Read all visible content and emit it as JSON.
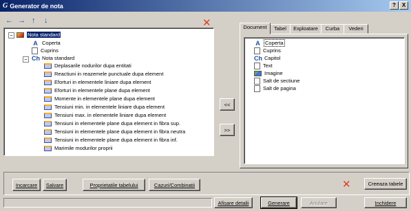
{
  "window": {
    "title": "Generator de nota",
    "app_icon": "G",
    "help_button": "?",
    "close_button": "X"
  },
  "toolbar": {
    "left_arrow": "←",
    "right_arrow": "→",
    "up_arrow": "↑",
    "down_arrow": "↓",
    "delete_icon": "✕"
  },
  "tree": {
    "root_label": "Nota standard",
    "root_expander": "−",
    "items": [
      {
        "icon": "A",
        "label": "Coperta"
      },
      {
        "icon": "doc",
        "label": "Cuprins"
      },
      {
        "icon": "Ch",
        "label": "Nota standard"
      }
    ],
    "chapter_expander": "−",
    "chapter_items": [
      "Deplasarile nodurilor dupa entitati",
      "Reactiuni in reazemele punctuale dupa element",
      "Eforturi in elementele liniare dupa element",
      "Eforturi in elementele plane dupa element",
      "Momente in elementele plane dupa element",
      "Tensiuni min. in elementele liniare dupa element",
      "Tensiuni max. in elementele liniare dupa element",
      "Tensiuni in elementele plane dupa element in fibra sup.",
      "Tensiuni in elementele plane dupa element in fibra neutra",
      "Tensiuni in elementele plane dupa element in fibra inf.",
      "Marimile modurilor proprii"
    ]
  },
  "middle": {
    "add_button": "<<",
    "remove_button": ">>"
  },
  "tabs": [
    "Document",
    "Tabel",
    "Exploatare",
    "Curba",
    "Vederi"
  ],
  "active_tab": "Document",
  "document_list": [
    {
      "icon": "A",
      "label": "Coperta"
    },
    {
      "icon": "doc",
      "label": "Cuprins"
    },
    {
      "icon": "Ch",
      "label": "Capitol"
    },
    {
      "icon": "doc",
      "label": "Text"
    },
    {
      "icon": "img",
      "label": "Imagine"
    },
    {
      "icon": "doc",
      "label": "Salt de sectiune"
    },
    {
      "icon": "doc",
      "label": "Salt de pagina"
    }
  ],
  "bottom": {
    "load_button": "Incarcare",
    "save_button": "Salvare",
    "table_props_button": "Proprietatile tabelului",
    "cases_button": "Cazuri/Combinatii",
    "delete_tables_icon": "✕",
    "create_tables_button": "Creeaza tabele",
    "details_button": "Afisare detalii",
    "generate_button": "Generare",
    "cancel_button": "Anulare",
    "close_button": "Inchidere"
  },
  "colors": {
    "titlebar_start": "#0a246a",
    "titlebar_end": "#a6caf0",
    "selection": "#0a246a",
    "delete_red": "#e04020",
    "face": "#d4d0c8"
  }
}
